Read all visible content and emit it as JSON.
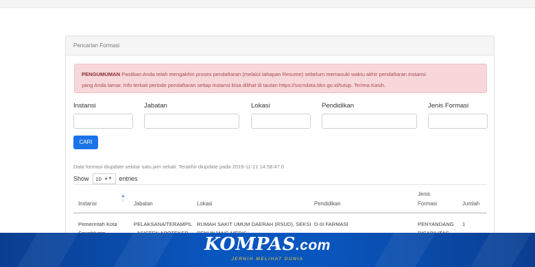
{
  "panel": {
    "title": "Pencarian Formasi"
  },
  "alert": {
    "label": "PENGUMUMAN",
    "line1": "Pastikan Anda telah mengakhiri proses pendaftaran (melalui tahapan Resume) sebelum memasuki waktu akhir pendaftaran instansi",
    "line2": "yang Anda lamar. Info terkait periode pendaftaran setiap instansi bisa dilihat di tautan https://sscndata.bkn.go.id/tutup. Terima Kasih."
  },
  "filters": {
    "instansi_label": "Instansi",
    "jabatan_label": "Jabatan",
    "lokasi_label": "Lokasi",
    "pendidikan_label": "Pendidikan",
    "jenis_formasi_label": "Jenis Formasi",
    "instansi_value": "",
    "jabatan_value": "",
    "lokasi_value": "",
    "pendidikan_value": "",
    "jenis_formasi_value": ""
  },
  "search_button": "CARI",
  "update_info": "Data formasi diupdate sekitar satu jam sekali. Terakhir diupdate pada 2019-11-21 14:58:47.0",
  "entries": {
    "show": "Show",
    "value": "10",
    "suffix": "entries"
  },
  "table": {
    "headers": [
      "Instansi",
      "Jabatan",
      "Lokasi",
      "Pendidikan",
      "Jenis Formasi",
      "Jumlah"
    ],
    "header_jenis_line1": "Jenis",
    "header_jenis_line2": "Formasi",
    "rows": [
      {
        "instansi": "Pemerintah Kota",
        "instansi_2": "Sawahlunto",
        "jabatan": "PELAKSANA/TERAMPIL",
        "jabatan_2": "- ASISTEN APOTEKER",
        "lokasi": "RUMAH SAKIT UMUM DAERAH (RSUD), SEKSI",
        "lokasi_2": "PENUNJANG MEDIS",
        "pendidikan": "D-III FARMASI",
        "jenis_formasi": "PENYANDANG",
        "jenis_formasi_2": "DISABILITAS",
        "jumlah": "1"
      }
    ]
  },
  "brand": {
    "logo": "KOMPAS",
    "domain": ".com",
    "tagline": "JERNIH MELIHAT DUNIA",
    "color_primary": "#0a56bf",
    "color_tagline": "#ffd21f"
  },
  "accent": "#1a73e8"
}
